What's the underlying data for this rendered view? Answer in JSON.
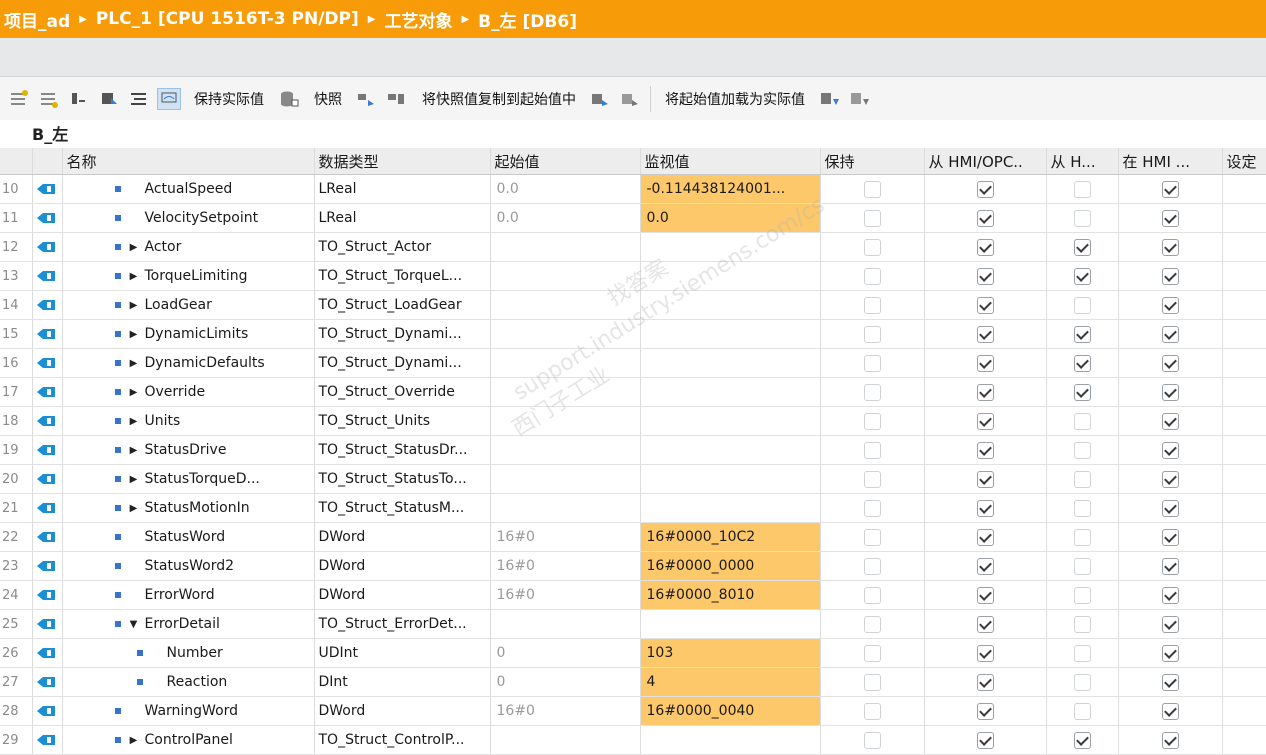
{
  "breadcrumb": [
    "项目_ad",
    "PLC_1 [CPU 1516T-3 PN/DP]",
    "工艺对象",
    "B_左 [DB6]"
  ],
  "toolbar": {
    "keep_actual": "保持实际值",
    "snapshot": "快照",
    "copy_snapshot": "将快照值复制到起始值中",
    "load_start": "将起始值加载为实际值"
  },
  "block_name": "B_左",
  "columns": {
    "name": "名称",
    "type": "数据类型",
    "start": "起始值",
    "monitor": "监视值",
    "retain": "保持",
    "hmi_opc": "从 HMI/OPC..",
    "from_h": "从 H...",
    "in_hmi": "在 HMI ...",
    "setpoint": "设定"
  },
  "watermark": [
    "找答案",
    "support.industry.siemens.com/cs",
    "西门子工业"
  ],
  "rows": [
    {
      "num": "10",
      "level": 1,
      "expander": "",
      "name": "ActualSpeed",
      "type": "LReal",
      "start": "0.0",
      "monitor": "-0.114438124001...",
      "hl": true,
      "retain": false,
      "hmi": true,
      "fromh": false,
      "inhmi": true
    },
    {
      "num": "11",
      "level": 1,
      "expander": "",
      "name": "VelocitySetpoint",
      "type": "LReal",
      "start": "0.0",
      "monitor": "0.0",
      "hl": true,
      "retain": false,
      "hmi": true,
      "fromh": false,
      "inhmi": true
    },
    {
      "num": "12",
      "level": 1,
      "expander": "▶",
      "name": "Actor",
      "type": "TO_Struct_Actor",
      "start": "",
      "monitor": "",
      "hl": false,
      "retain": false,
      "hmi": true,
      "fromh": true,
      "inhmi": true
    },
    {
      "num": "13",
      "level": 1,
      "expander": "▶",
      "name": "TorqueLimiting",
      "type": "TO_Struct_TorqueL...",
      "start": "",
      "monitor": "",
      "hl": false,
      "retain": false,
      "hmi": true,
      "fromh": true,
      "inhmi": true
    },
    {
      "num": "14",
      "level": 1,
      "expander": "▶",
      "name": "LoadGear",
      "type": "TO_Struct_LoadGear",
      "start": "",
      "monitor": "",
      "hl": false,
      "retain": false,
      "hmi": true,
      "fromh": false,
      "inhmi": true
    },
    {
      "num": "15",
      "level": 1,
      "expander": "▶",
      "name": "DynamicLimits",
      "type": "TO_Struct_Dynami...",
      "start": "",
      "monitor": "",
      "hl": false,
      "retain": false,
      "hmi": true,
      "fromh": true,
      "inhmi": true
    },
    {
      "num": "16",
      "level": 1,
      "expander": "▶",
      "name": "DynamicDefaults",
      "type": "TO_Struct_Dynami...",
      "start": "",
      "monitor": "",
      "hl": false,
      "retain": false,
      "hmi": true,
      "fromh": true,
      "inhmi": true
    },
    {
      "num": "17",
      "level": 1,
      "expander": "▶",
      "name": "Override",
      "type": "TO_Struct_Override",
      "start": "",
      "monitor": "",
      "hl": false,
      "retain": false,
      "hmi": true,
      "fromh": true,
      "inhmi": true
    },
    {
      "num": "18",
      "level": 1,
      "expander": "▶",
      "name": "Units",
      "type": "TO_Struct_Units",
      "start": "",
      "monitor": "",
      "hl": false,
      "retain": false,
      "hmi": true,
      "fromh": false,
      "inhmi": true
    },
    {
      "num": "19",
      "level": 1,
      "expander": "▶",
      "name": "StatusDrive",
      "type": "TO_Struct_StatusDr...",
      "start": "",
      "monitor": "",
      "hl": false,
      "retain": false,
      "hmi": true,
      "fromh": false,
      "inhmi": true
    },
    {
      "num": "20",
      "level": 1,
      "expander": "▶",
      "name": "StatusTorqueD...",
      "type": "TO_Struct_StatusTo...",
      "start": "",
      "monitor": "",
      "hl": false,
      "retain": false,
      "hmi": true,
      "fromh": false,
      "inhmi": true
    },
    {
      "num": "21",
      "level": 1,
      "expander": "▶",
      "name": "StatusMotionIn",
      "type": "TO_Struct_StatusM...",
      "start": "",
      "monitor": "",
      "hl": false,
      "retain": false,
      "hmi": true,
      "fromh": false,
      "inhmi": true
    },
    {
      "num": "22",
      "level": 1,
      "expander": "",
      "name": "StatusWord",
      "type": "DWord",
      "start": "16#0",
      "monitor": "16#0000_10C2",
      "hl": true,
      "retain": false,
      "hmi": true,
      "fromh": false,
      "inhmi": true
    },
    {
      "num": "23",
      "level": 1,
      "expander": "",
      "name": "StatusWord2",
      "type": "DWord",
      "start": "16#0",
      "monitor": "16#0000_0000",
      "hl": true,
      "retain": false,
      "hmi": true,
      "fromh": false,
      "inhmi": true
    },
    {
      "num": "24",
      "level": 1,
      "expander": "",
      "name": "ErrorWord",
      "type": "DWord",
      "start": "16#0",
      "monitor": "16#0000_8010",
      "hl": true,
      "retain": false,
      "hmi": true,
      "fromh": false,
      "inhmi": true
    },
    {
      "num": "25",
      "level": 1,
      "expander": "▼",
      "name": "ErrorDetail",
      "type": "TO_Struct_ErrorDet...",
      "start": "",
      "monitor": "",
      "hl": false,
      "retain": false,
      "hmi": true,
      "fromh": false,
      "inhmi": true
    },
    {
      "num": "26",
      "level": 2,
      "expander": "",
      "name": "Number",
      "type": "UDInt",
      "start": "0",
      "monitor": "103",
      "hl": true,
      "retain": false,
      "hmi": true,
      "fromh": false,
      "inhmi": true
    },
    {
      "num": "27",
      "level": 2,
      "expander": "",
      "name": "Reaction",
      "type": "DInt",
      "start": "0",
      "monitor": "4",
      "hl": true,
      "retain": false,
      "hmi": true,
      "fromh": false,
      "inhmi": true
    },
    {
      "num": "28",
      "level": 1,
      "expander": "",
      "name": "WarningWord",
      "type": "DWord",
      "start": "16#0",
      "monitor": "16#0000_0040",
      "hl": true,
      "retain": false,
      "hmi": true,
      "fromh": false,
      "inhmi": true
    },
    {
      "num": "29",
      "level": 1,
      "expander": "▶",
      "name": "ControlPanel",
      "type": "TO_Struct_ControlP...",
      "start": "",
      "monitor": "",
      "hl": false,
      "retain": false,
      "hmi": true,
      "fromh": true,
      "inhmi": true
    }
  ]
}
